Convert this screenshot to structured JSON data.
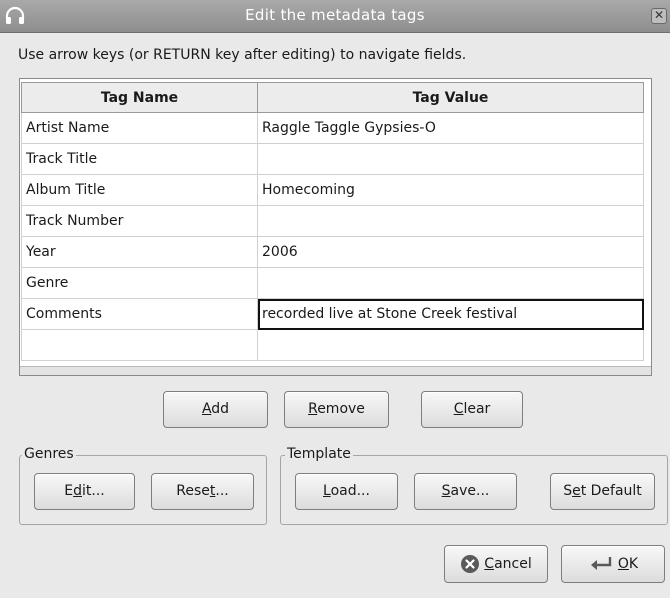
{
  "window": {
    "title": "Edit the metadata tags",
    "close_glyph": "✕",
    "app_icon": "headphones-icon"
  },
  "instructions": "Use arrow keys (or RETURN key after editing) to navigate fields.",
  "table": {
    "headers": [
      "Tag Name",
      "Tag Value"
    ],
    "rows": [
      {
        "name": "Artist Name",
        "value": "Raggle Taggle Gypsies-O"
      },
      {
        "name": "Track Title",
        "value": ""
      },
      {
        "name": "Album Title",
        "value": "Homecoming"
      },
      {
        "name": "Track Number",
        "value": ""
      },
      {
        "name": "Year",
        "value": "2006"
      },
      {
        "name": "Genre",
        "value": ""
      },
      {
        "name": "Comments",
        "value": "recorded live at Stone Creek festival"
      },
      {
        "name": "",
        "value": ""
      }
    ]
  },
  "buttons": {
    "add": {
      "mn": "A",
      "rest": "dd"
    },
    "remove": {
      "mn": "R",
      "rest": "emove"
    },
    "clear": {
      "mn": "C",
      "rest": "lear"
    }
  },
  "genres": {
    "label": "Genres",
    "edit": {
      "pre": "E",
      "mn": "d",
      "post": "it..."
    },
    "reset": {
      "pre": "Rese",
      "mn": "t",
      "post": "..."
    }
  },
  "template": {
    "label": "Template",
    "load": {
      "pre": "",
      "mn": "L",
      "post": "oad..."
    },
    "save": {
      "pre": "",
      "mn": "S",
      "post": "ave..."
    },
    "set_default": {
      "pre": "S",
      "mn": "e",
      "post": "t Default"
    }
  },
  "dialog": {
    "cancel": {
      "mn": "C",
      "rest": "ancel",
      "icon": "cancel-icon"
    },
    "ok": {
      "mn": "O",
      "rest": "K",
      "icon": "ok-icon"
    }
  }
}
